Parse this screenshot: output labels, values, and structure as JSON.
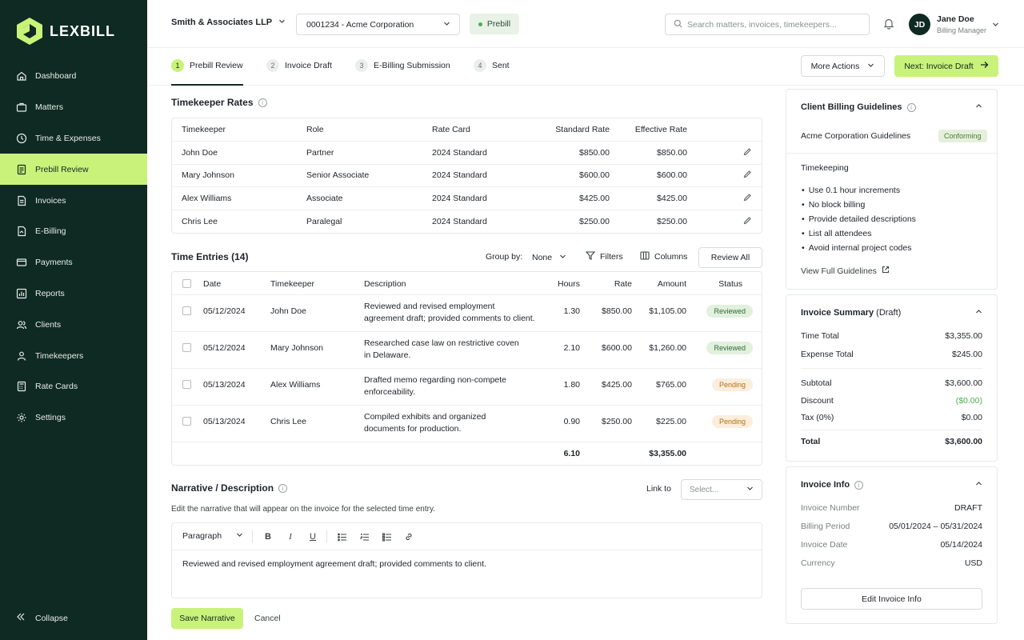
{
  "app": {
    "name": "LEXBILL"
  },
  "sidebar": {
    "items": [
      {
        "label": "Dashboard",
        "icon": "home-icon"
      },
      {
        "label": "Matters",
        "icon": "briefcase-icon"
      },
      {
        "label": "Time & Expenses",
        "icon": "clock-icon"
      },
      {
        "label": "Prebill Review",
        "icon": "document-icon",
        "active": true
      },
      {
        "label": "Invoices",
        "icon": "invoice-icon"
      },
      {
        "label": "E-Billing",
        "icon": "ebilling-icon"
      },
      {
        "label": "Payments",
        "icon": "card-icon"
      },
      {
        "label": "Reports",
        "icon": "chart-icon"
      },
      {
        "label": "Clients",
        "icon": "users-icon"
      },
      {
        "label": "Timekeepers",
        "icon": "user-group-icon"
      },
      {
        "label": "Rate Cards",
        "icon": "calculator-icon"
      },
      {
        "label": "Settings",
        "icon": "gear-icon"
      }
    ],
    "collapse_label": "Collapse"
  },
  "header": {
    "firm": "Smith & Associates LLP",
    "matter": "0001234 - Acme Corporation",
    "status_badge": "Prebill",
    "search_placeholder": "Search matters, invoices, timekeepers...",
    "user_initials": "JD",
    "user_name": "Jane Doe",
    "user_role": "Billing Manager"
  },
  "stepper": {
    "steps": [
      {
        "num": "1",
        "label": "Prebill Review"
      },
      {
        "num": "2",
        "label": "Invoice Draft"
      },
      {
        "num": "3",
        "label": "E-Billing Submission"
      },
      {
        "num": "4",
        "label": "Sent"
      }
    ],
    "more_actions": "More Actions",
    "next_button": "Next: Invoice Draft"
  },
  "timekeeper_rates": {
    "title": "Timekeeper Rates",
    "columns": [
      "Timekeeper",
      "Role",
      "Rate Card",
      "Standard Rate",
      "Effective Rate"
    ],
    "rows": [
      {
        "name": "John Doe",
        "role": "Partner",
        "card": "2024 Standard",
        "standard": "$850.00",
        "effective": "$850.00"
      },
      {
        "name": "Mary Johnson",
        "role": "Senior Associate",
        "card": "2024 Standard",
        "standard": "$600.00",
        "effective": "$600.00"
      },
      {
        "name": "Alex Williams",
        "role": "Associate",
        "card": "2024 Standard",
        "standard": "$425.00",
        "effective": "$425.00"
      },
      {
        "name": "Chris Lee",
        "role": "Paralegal",
        "card": "2024 Standard",
        "standard": "$250.00",
        "effective": "$250.00"
      }
    ]
  },
  "time_entries": {
    "title": "Time Entries (14)",
    "group_by_label": "Group by:",
    "group_by_value": "None",
    "filters_label": "Filters",
    "columns_label": "Columns",
    "review_all": "Review All",
    "columns": [
      "Date",
      "Timekeeper",
      "Description",
      "Hours",
      "Rate",
      "Amount",
      "Status"
    ],
    "rows": [
      {
        "date": "05/12/2024",
        "timekeeper": "John Doe",
        "desc": "Reviewed and revised employment agreement draft; provided comments to client.",
        "hours": "1.30",
        "rate": "$850.00",
        "amount": "$1,105.00",
        "status": "Reviewed"
      },
      {
        "date": "05/12/2024",
        "timekeeper": "Mary Johnson",
        "desc": "Researched case law on restrictive coven in Delaware.",
        "hours": "2.10",
        "rate": "$600.00",
        "amount": "$1,260.00",
        "status": "Reviewed"
      },
      {
        "date": "05/13/2024",
        "timekeeper": "Alex Williams",
        "desc": "Drafted memo regarding non-compete enforceability.",
        "hours": "1.80",
        "rate": "$425.00",
        "amount": "$765.00",
        "status": "Pending"
      },
      {
        "date": "05/13/2024",
        "timekeeper": "Chris Lee",
        "desc": "Compiled exhibits and organized documents for production.",
        "hours": "0.90",
        "rate": "$250.00",
        "amount": "$225.00",
        "status": "Pending"
      }
    ],
    "total_hours": "6.10",
    "total_amount": "$3,355.00"
  },
  "narrative": {
    "title": "Narrative / Description",
    "subtitle": "Edit the narrative that will appear on the invoice for the selected time entry.",
    "link_to_label": "Link to",
    "link_to_placeholder": "Select...",
    "format_value": "Paragraph",
    "text": "Reviewed and revised employment agreement draft; provided comments to client.",
    "save": "Save Narrative",
    "cancel": "Cancel"
  },
  "guidelines": {
    "title": "Client Billing Guidelines",
    "client": "Acme Corporation Guidelines",
    "status": "Conforming",
    "section": "Timekeeping",
    "items": [
      "Use 0.1 hour increments",
      "No block billing",
      "Provide detailed descriptions",
      "List all attendees",
      "Avoid internal project codes"
    ],
    "view_full": "View Full Guidelines"
  },
  "summary": {
    "title": "Invoice Summary",
    "title_suffix": "(Draft)",
    "time_total_label": "Time Total",
    "time_total": "$3,355.00",
    "expense_total_label": "Expense Total",
    "expense_total": "$245.00",
    "subtotal_label": "Subtotal",
    "subtotal": "$3,600.00",
    "discount_label": "Discount",
    "discount": "($0.00)",
    "tax_label": "Tax (0%)",
    "tax": "$0.00",
    "total_label": "Total",
    "total": "$3,600.00"
  },
  "invoice_info": {
    "title": "Invoice Info",
    "number_label": "Invoice Number",
    "number": "DRAFT",
    "period_label": "Billing Period",
    "period": "05/01/2024 – 05/31/2024",
    "date_label": "Invoice Date",
    "date": "05/14/2024",
    "currency_label": "Currency",
    "currency": "USD",
    "edit_button": "Edit Invoice Info"
  }
}
